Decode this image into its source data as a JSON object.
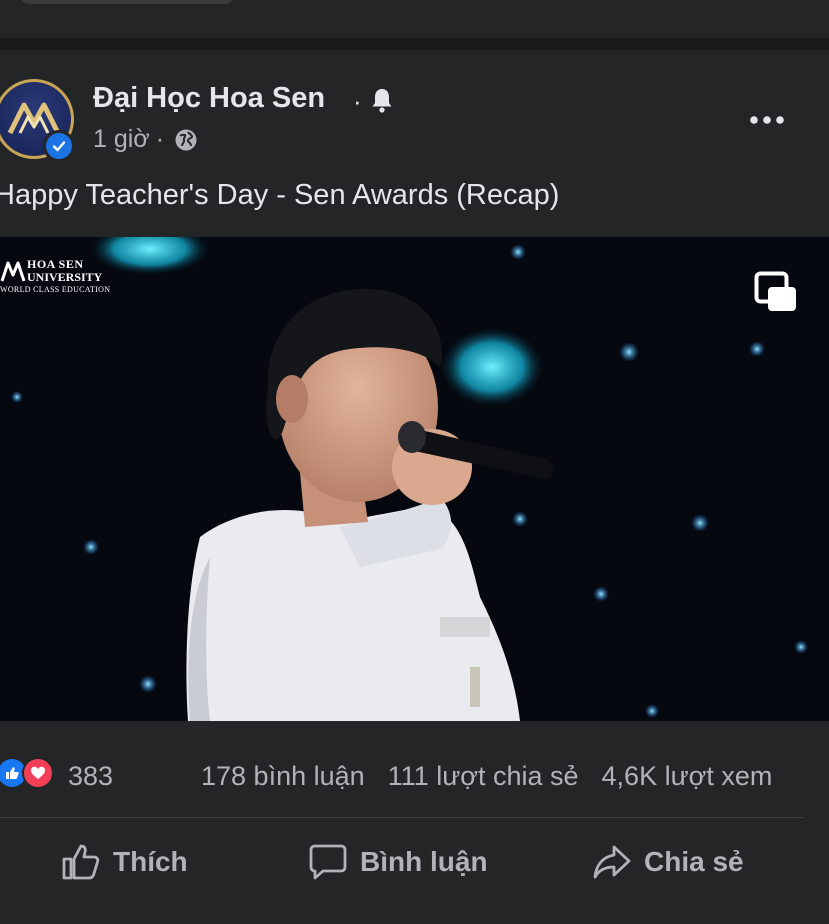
{
  "post": {
    "page_name": "Đại Học Hoa Sen",
    "name_separator": "·",
    "time": "1 giờ",
    "meta_separator": "·",
    "caption": "Happy Teacher's Day - Sen Awards (Recap)"
  },
  "video": {
    "watermark_line1": "HOA SEN",
    "watermark_line2": "UNIVERSITY",
    "watermark_line3": "WORLD CLASS EDUCATION"
  },
  "engagement": {
    "reaction_count": "383",
    "comments": "178 bình luận",
    "shares": "111 lượt chia sẻ",
    "views": "4,6K lượt xem"
  },
  "actions": {
    "like_label": "Thích",
    "comment_label": "Bình luận",
    "share_label": "Chia sẻ"
  },
  "icons": [
    "bell-icon",
    "globe-icon",
    "more-icon",
    "verified-badge-icon",
    "picture-in-picture-icon",
    "like-reaction-icon",
    "love-reaction-icon",
    "thumbs-up-icon",
    "comment-icon",
    "share-icon"
  ],
  "colors": {
    "background": "#18191a",
    "card": "#242526",
    "primary_text": "#e4e6eb",
    "secondary_text": "#b0b3b8",
    "like_blue": "#1877f2",
    "love_red": "#f33e58",
    "verified_blue": "#1b74e4"
  }
}
